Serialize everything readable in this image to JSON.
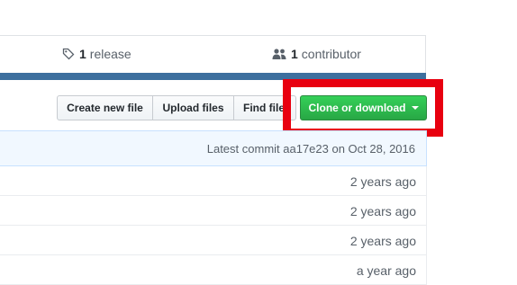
{
  "stats": {
    "releases": {
      "count": "1",
      "label": "release",
      "icon": "tag-icon"
    },
    "contributors": {
      "count": "1",
      "label": "contributor",
      "icon": "people-icon"
    }
  },
  "colors": {
    "language_bar": "#3d6f9e",
    "clone_button": "#2ea44f",
    "highlight_box": "#e8000f"
  },
  "toolbar": {
    "create_label": "Create new file",
    "upload_label": "Upload files",
    "find_label": "Find file",
    "clone_label": "Clone or download"
  },
  "commit": {
    "text": "Latest commit aa17e23 on Oct 28, 2016"
  },
  "files": [
    {
      "age": "2 years ago"
    },
    {
      "age": "2 years ago"
    },
    {
      "age": "2 years ago"
    },
    {
      "age": "a year ago"
    }
  ]
}
